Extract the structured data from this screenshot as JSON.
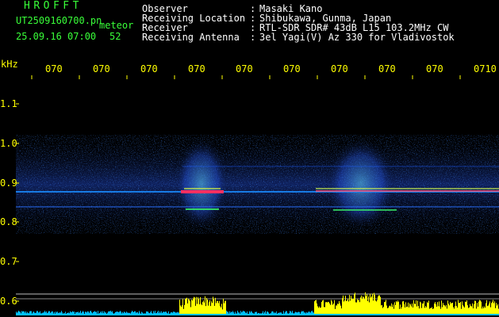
{
  "brand": "HROFFT",
  "filename": "UT2509160700.pn",
  "mode": "meteor",
  "datetime": "25.09.16 07:00",
  "count": "52",
  "info": [
    {
      "label": "Observer",
      "value": "Masaki Kano"
    },
    {
      "label": "Receiving Location",
      "value": "Shibukawa, Gunma, Japan"
    },
    {
      "label": "Receiver",
      "value": "RTL-SDR SDR# 43dB L15 103.2MHz CW"
    },
    {
      "label": "Receiving Antenna",
      "value": "3el Yagi(V) Az 330 for Vladivostok"
    }
  ],
  "colon": ":",
  "axis": {
    "unit": "kHz",
    "y_ticks": [
      "1.1",
      "1.0",
      "0.9",
      "0.8",
      "0.7",
      "0.6"
    ],
    "x_ticks": [
      "070",
      "070",
      "070",
      "070",
      "070",
      "070",
      "070",
      "070",
      "070",
      "0710"
    ]
  },
  "colors": {
    "background": "#000000",
    "header_green": "#39ff39",
    "header_white": "#ffffff",
    "axis_yellow": "#ffff00",
    "signal_strong": "#ff3060",
    "signal_weak": "#2060ff",
    "histogram": "#ffff00",
    "histogram_base": "#00c0ff"
  }
}
